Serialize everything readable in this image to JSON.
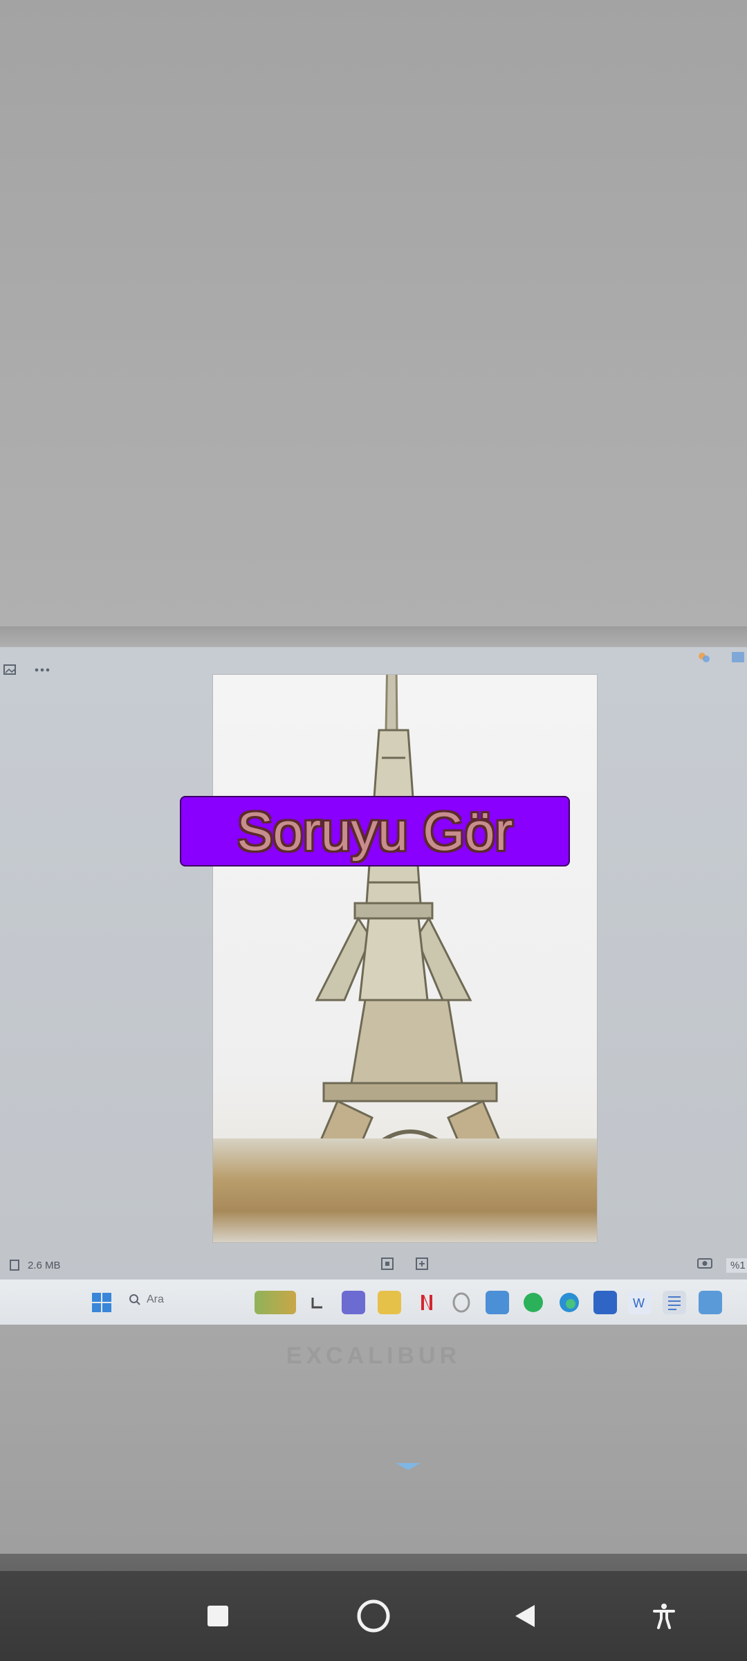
{
  "viewer": {
    "file_size": "2.6 MB",
    "zoom": "%1"
  },
  "taskbar": {
    "search_placeholder": "Ara"
  },
  "laptop": {
    "brand": "EXCALIBUR"
  },
  "overlay": {
    "button_label": "Soruyu Gör",
    "button_color": "#8a00ff"
  },
  "icons": {
    "viewer_left": "gallery-icon",
    "viewer_more": "more-icon",
    "taskbar": [
      "windows-start-icon",
      "search-icon",
      "widgets-icon",
      "taskview-icon",
      "teams-icon",
      "file-explorer-icon",
      "netflix-icon",
      "opera-icon",
      "mail-icon",
      "spotify-icon",
      "edge-icon",
      "word-icon",
      "word-icon",
      "notepad-icon",
      "photos-icon"
    ],
    "nav": [
      "recents-icon",
      "home-icon",
      "back-icon",
      "accessibility-icon"
    ]
  }
}
